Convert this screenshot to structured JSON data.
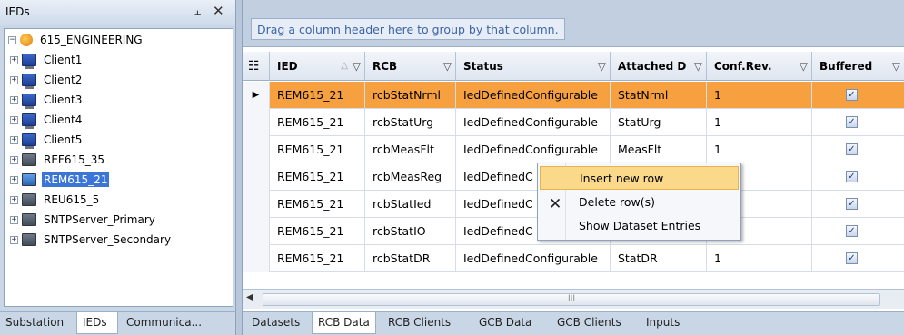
{
  "left_panel": {
    "title": "IEDs",
    "pin_icon": "%A",
    "close_icon": "✕",
    "tree": [
      {
        "label": "615_ENGINEERING",
        "icon": "root-icon",
        "expander": "−"
      },
      {
        "label": "Client1",
        "icon": "computer-icon",
        "expander": "+"
      },
      {
        "label": "Client2",
        "icon": "computer-icon",
        "expander": "+"
      },
      {
        "label": "Client3",
        "icon": "computer-icon",
        "expander": "+"
      },
      {
        "label": "Client4",
        "icon": "computer-icon",
        "expander": "+"
      },
      {
        "label": "Client5",
        "icon": "computer-icon",
        "expander": "+"
      },
      {
        "label": "REF615_35",
        "icon": "ied-icon",
        "expander": "+"
      },
      {
        "label": "REM615_21",
        "icon": "ied-icon",
        "expander": "+",
        "selected": true
      },
      {
        "label": "REU615_5",
        "icon": "ied-icon",
        "expander": "+"
      },
      {
        "label": "SNTPServer_Primary",
        "icon": "ied-icon",
        "expander": "+"
      },
      {
        "label": "SNTPServer_Secondary",
        "icon": "ied-icon",
        "expander": "+"
      }
    ],
    "tabs": [
      "Substation",
      "IEDs",
      "Communica..."
    ],
    "active_tab": "IEDs"
  },
  "grid": {
    "group_hint": "Drag a column header here to group by that column.",
    "columns": [
      {
        "label": "IED",
        "sort": "△",
        "filter": "▽"
      },
      {
        "label": "RCB",
        "filter": "▽"
      },
      {
        "label": "Status",
        "filter": "▽"
      },
      {
        "label": "Attached D",
        "filter": "▽"
      },
      {
        "label": "Conf.Rev.",
        "filter": "▽"
      },
      {
        "label": "Buffered",
        "filter": "▽"
      }
    ],
    "rows": [
      {
        "ied": "REM615_21",
        "rcb": "rcbStatNrml",
        "status": "IedDefinedConfigurable",
        "attached": "StatNrml",
        "conf": "1",
        "buffered": true,
        "selected": true
      },
      {
        "ied": "REM615_21",
        "rcb": "rcbStatUrg",
        "status": "IedDefinedConfigurable",
        "attached": "StatUrg",
        "conf": "1",
        "buffered": true
      },
      {
        "ied": "REM615_21",
        "rcb": "rcbMeasFlt",
        "status": "IedDefinedConfigurable",
        "attached": "MeasFlt",
        "conf": "1",
        "buffered": true
      },
      {
        "ied": "REM615_21",
        "rcb": "rcbMeasReg",
        "status": "IedDefinedC",
        "attached": "",
        "conf": "",
        "buffered": true
      },
      {
        "ied": "REM615_21",
        "rcb": "rcbStatIed",
        "status": "IedDefinedC",
        "attached": "",
        "conf": "",
        "buffered": true
      },
      {
        "ied": "REM615_21",
        "rcb": "rcbStatIO",
        "status": "IedDefinedC",
        "attached": "",
        "conf": "",
        "buffered": true
      },
      {
        "ied": "REM615_21",
        "rcb": "rcbStatDR",
        "status": "IedDefinedConfigurable",
        "attached": "StatDR",
        "conf": "1",
        "buffered": true
      }
    ],
    "scroll_grip": "III",
    "bottom_tabs": [
      "Datasets",
      "RCB Data",
      "RCB Clients",
      "GCB Data",
      "GCB Clients",
      "Inputs"
    ],
    "active_bottom_tab": "RCB Data"
  },
  "context_menu": {
    "items": [
      "Insert new row",
      "Delete row(s)",
      "Show Dataset Entries"
    ],
    "highlighted": "Insert new row"
  },
  "colors": {
    "selected_row": "#f6a03f",
    "tree_selection": "#3b76d6",
    "menu_highlight": "#fbd98a"
  }
}
